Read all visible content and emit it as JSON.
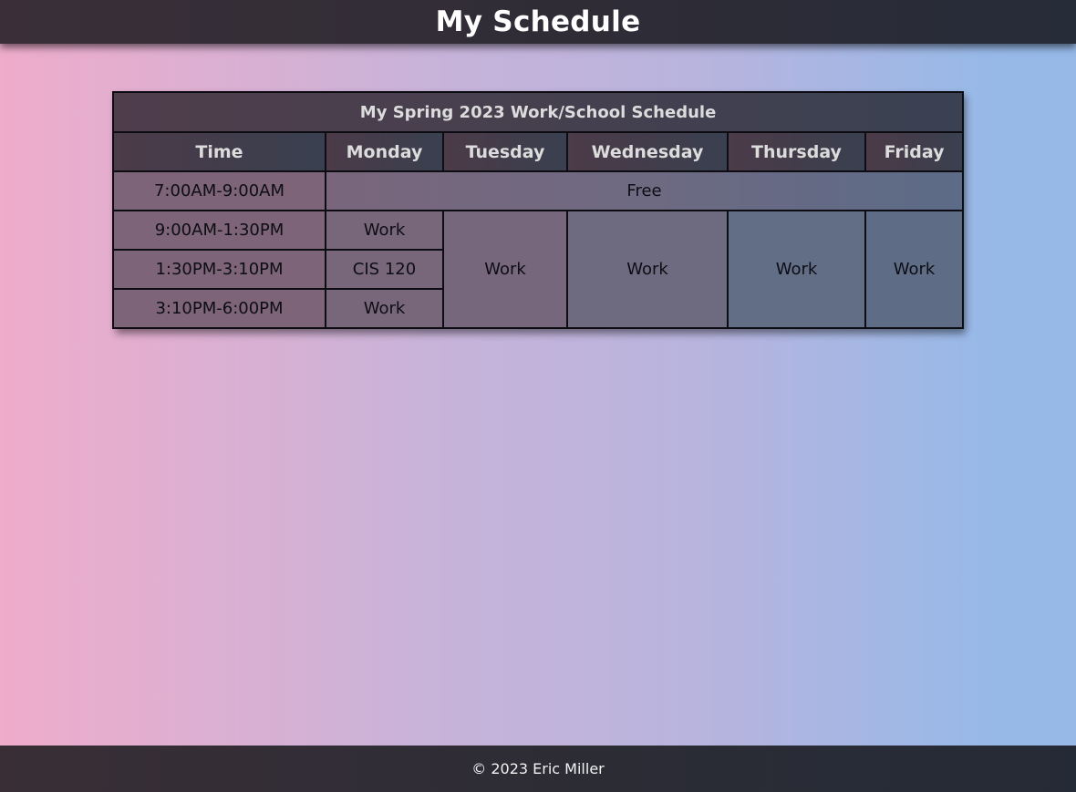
{
  "header": {
    "title": "My Schedule"
  },
  "schedule": {
    "caption": "My Spring 2023 Work/School Schedule",
    "columns": [
      "Time",
      "Monday",
      "Tuesday",
      "Wednesday",
      "Thursday",
      "Friday"
    ],
    "rows": [
      {
        "time": "7:00AM-9:00AM",
        "all_days": "Free"
      },
      {
        "time": "9:00AM-1:30PM",
        "monday": "Work",
        "tuesday": "Work",
        "wednesday": "Work",
        "thursday": "Work",
        "friday": "Work"
      },
      {
        "time": "1:30PM-3:10PM",
        "monday": "CIS 120"
      },
      {
        "time": "3:10PM-6:00PM",
        "monday": "Work"
      }
    ]
  },
  "footer": {
    "copyright": "© 2023 Eric Miller"
  }
}
